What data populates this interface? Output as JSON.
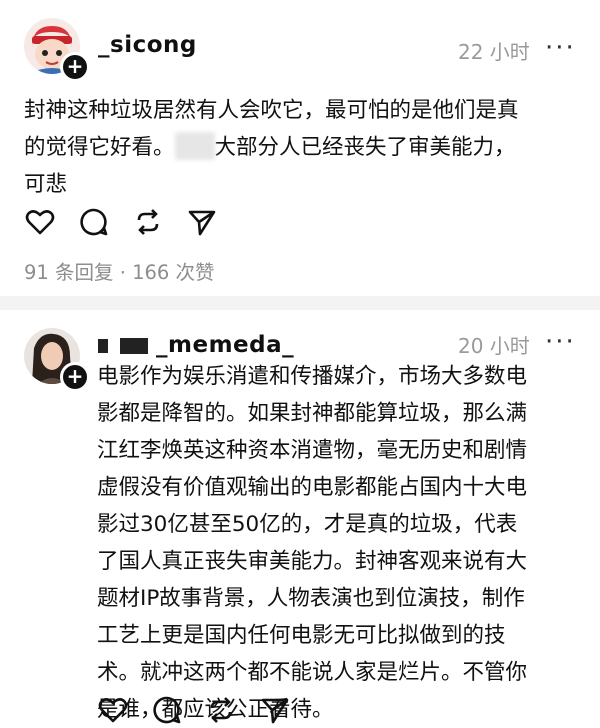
{
  "posts": [
    {
      "username": "_sicong",
      "time": "22 小时",
      "more_label": "···",
      "content_lines": [
        {
          "before": "封神这种垃圾居然有人会吹它，最可怕的是他们是真",
          "after": ""
        },
        {
          "before": "的觉得它好看。",
          "after": "大部分人已经丧失了审美能力，"
        },
        {
          "before": "可悲",
          "after": ""
        }
      ],
      "stats": "91 条回复 · 166 次赞"
    },
    {
      "username": "_memeda_",
      "time": "20 小时",
      "more_label": "···",
      "content_lines": [
        "电影作为娱乐消遣和传播媒介，市场大多数电",
        "影都是降智的。如果封神都能算垃圾，那么满",
        "江红李焕英这种资本消遣物，毫无历史和剧情",
        "虚假没有价值观输出的电影都能占国内十大电",
        "影过30亿甚至50亿的，才是真的垃圾，代表",
        "了国人真正丧失审美能力。封神客观来说有大",
        "题材IP故事背景，人物表演也到位演技，制作",
        "工艺上更是国内任何电影无可比拟做到的技",
        "术。就冲这两个都不能说人家是烂片。不管你",
        "是谁，都应该公正看待。"
      ]
    }
  ],
  "icons": [
    "heart-icon",
    "comment-icon",
    "repost-icon",
    "share-icon"
  ],
  "colors": {
    "text": "#101010",
    "muted": "#9a9a9a",
    "divider": "#f3f3f3",
    "badge": "#111111"
  }
}
